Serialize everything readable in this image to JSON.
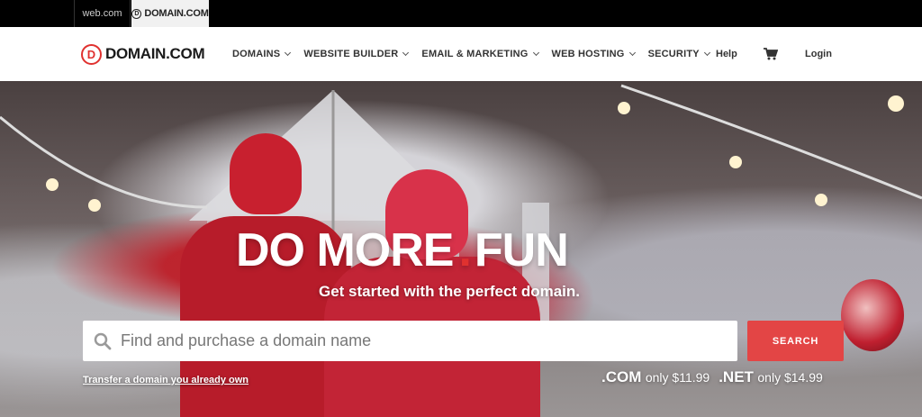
{
  "brandbar": {
    "tabs": [
      {
        "label": "web.com"
      },
      {
        "label": "DOMAIN.COM",
        "logo_letter": "D"
      }
    ]
  },
  "nav": {
    "logo": {
      "letter": "D",
      "text": "DOMAIN.COM"
    },
    "menu": [
      {
        "label": "DOMAINS"
      },
      {
        "label": "WEBSITE BUILDER"
      },
      {
        "label": "EMAIL & MARKETING"
      },
      {
        "label": "WEB HOSTING"
      },
      {
        "label": "SECURITY"
      }
    ],
    "help": "Help",
    "cart_icon": "shopping-cart-icon",
    "login": "Login"
  },
  "hero": {
    "headline_part1": "DO MORE",
    "headline_dot": ".",
    "headline_part2": "FUN",
    "tagline": "Get started with the perfect domain.",
    "search": {
      "placeholder": "Find and purchase a domain name",
      "button": "SEARCH"
    },
    "transfer_link": "Transfer a domain you already own",
    "prices": [
      {
        "tld": ".COM",
        "text": "only $11.99"
      },
      {
        "tld": ".NET",
        "text": "only $14.99"
      }
    ]
  },
  "colors": {
    "brand_red": "#e0312f",
    "search_button": "#e34545",
    "top_bar": "#000000"
  }
}
